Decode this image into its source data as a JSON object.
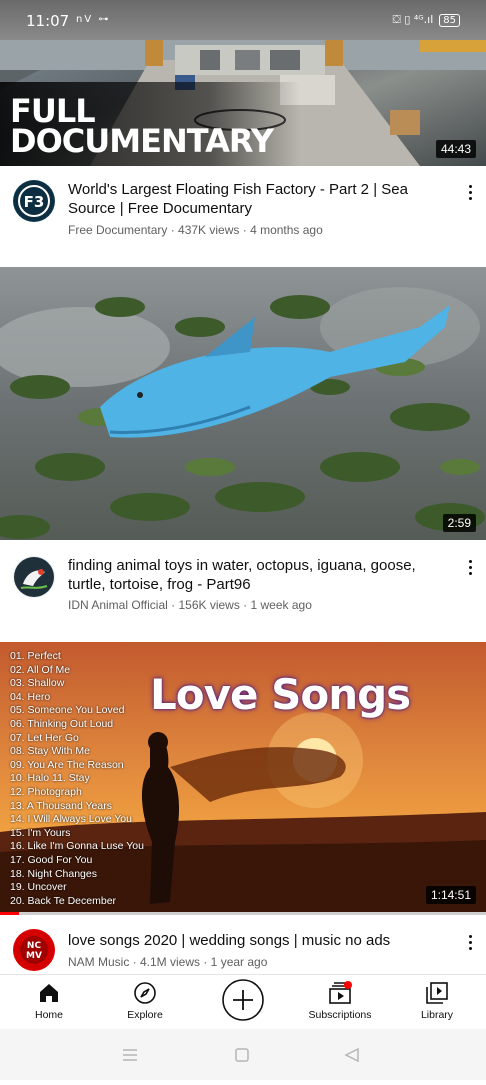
{
  "status_bar": {
    "time": "11:07",
    "left_icons": "nV ⊶",
    "right_icons": "⛋ ▯ ⁴ᴳ.ıl",
    "battery": "85"
  },
  "videos": [
    {
      "overlay_line1": "FULL",
      "overlay_line2": "DOCUMENTARY",
      "duration": "44:43",
      "title": "World's Largest Floating Fish Factory - Part 2 | Sea Source | Free Documentary",
      "channel_meta": "Free Documentary · 437K views · 4 months ago",
      "avatar_text": "FD"
    },
    {
      "duration": "2:59",
      "title": "finding animal toys in water, octopus, iguana, goose, turtle, tortoise, frog - Part96",
      "channel_meta": "IDN Animal Official · 156K views · 1 week ago"
    },
    {
      "overlay_title": "Love Songs",
      "tracklist": [
        "01. Perfect",
        "02. All Of Me",
        "03. Shallow",
        "04. Hero",
        "05. Someone You Loved",
        "06. Thinking Out Loud",
        "07. Let Her Go",
        "08. Stay With Me",
        "09. You Are The Reason",
        "10. Halo 11. Stay",
        "12. Photograph",
        "13. A Thousand Years",
        "14. I Will Always Love You",
        "15. I'm Yours",
        "16. Like I'm Gonna Luse You",
        "17. Good For You",
        "18. Night Changes",
        "19. Uncover",
        "20. Back Te December"
      ],
      "duration": "1:14:51",
      "title": "love songs 2020 | wedding songs | music no ads",
      "channel_meta": "NAM Music · 4.1M views · 1 year ago",
      "avatar_text": "NC MV",
      "watch_progress": 0.04
    }
  ],
  "bottom_nav": {
    "home": "Home",
    "explore": "Explore",
    "subscriptions": "Subscriptions",
    "library": "Library"
  },
  "colors": {
    "accent_red": "#ff0000",
    "text_primary": "#0f0f0f",
    "text_secondary": "#606060"
  }
}
